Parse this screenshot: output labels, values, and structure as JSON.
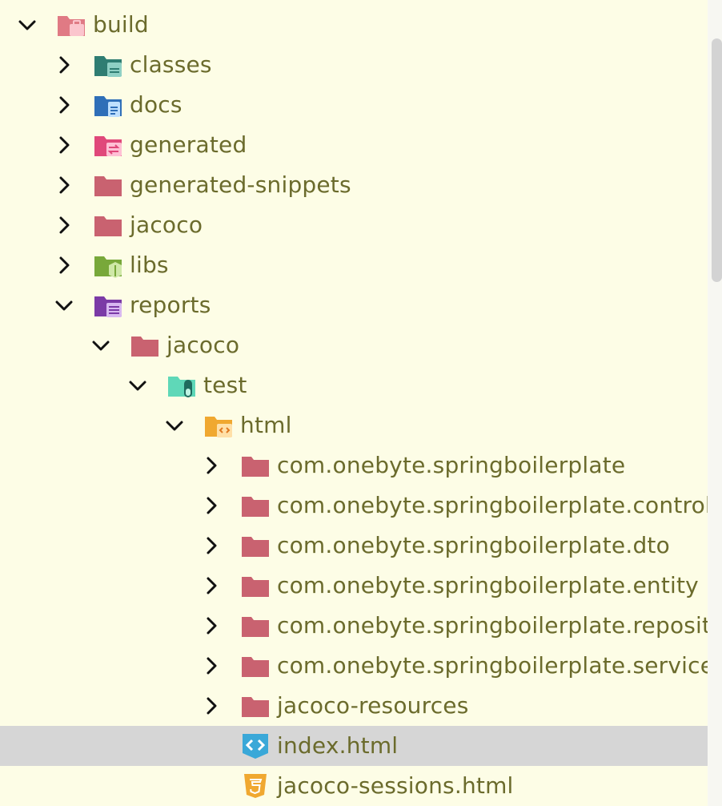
{
  "tree": {
    "items": [
      {
        "label": "build",
        "depth": 0,
        "expanded": true,
        "icon": "folder-build-icon",
        "color": "#e07a84"
      },
      {
        "label": "classes",
        "depth": 1,
        "expanded": false,
        "icon": "folder-classes-icon",
        "color": "#2f7d72"
      },
      {
        "label": "docs",
        "depth": 1,
        "expanded": false,
        "icon": "folder-docs-icon",
        "color": "#2f6fb8"
      },
      {
        "label": "generated",
        "depth": 1,
        "expanded": false,
        "icon": "folder-generated-icon",
        "color": "#e0487a"
      },
      {
        "label": "generated-snippets",
        "depth": 1,
        "expanded": false,
        "icon": "folder-icon",
        "color": "#c96270"
      },
      {
        "label": "jacoco",
        "depth": 1,
        "expanded": false,
        "icon": "folder-icon",
        "color": "#c96270"
      },
      {
        "label": "libs",
        "depth": 1,
        "expanded": false,
        "icon": "folder-libs-icon",
        "color": "#78a83a"
      },
      {
        "label": "reports",
        "depth": 1,
        "expanded": true,
        "icon": "folder-reports-icon",
        "color": "#7b3aa6"
      },
      {
        "label": "jacoco",
        "depth": 2,
        "expanded": true,
        "icon": "folder-icon",
        "color": "#c96270"
      },
      {
        "label": "test",
        "depth": 3,
        "expanded": true,
        "icon": "folder-test-icon",
        "color": "#5fd8b8"
      },
      {
        "label": "html",
        "depth": 4,
        "expanded": true,
        "icon": "folder-html-icon",
        "color": "#f0a830"
      },
      {
        "label": "com.onebyte.springboilerplate",
        "depth": 5,
        "expanded": false,
        "icon": "folder-icon",
        "color": "#c96270"
      },
      {
        "label": "com.onebyte.springboilerplate.controller",
        "depth": 5,
        "expanded": false,
        "icon": "folder-icon",
        "color": "#c96270"
      },
      {
        "label": "com.onebyte.springboilerplate.dto",
        "depth": 5,
        "expanded": false,
        "icon": "folder-icon",
        "color": "#c96270"
      },
      {
        "label": "com.onebyte.springboilerplate.entity",
        "depth": 5,
        "expanded": false,
        "icon": "folder-icon",
        "color": "#c96270"
      },
      {
        "label": "com.onebyte.springboilerplate.repository",
        "depth": 5,
        "expanded": false,
        "icon": "folder-icon",
        "color": "#c96270"
      },
      {
        "label": "com.onebyte.springboilerplate.service",
        "depth": 5,
        "expanded": false,
        "icon": "folder-icon",
        "color": "#c96270"
      },
      {
        "label": "jacoco-resources",
        "depth": 5,
        "expanded": false,
        "icon": "folder-icon",
        "color": "#c96270"
      },
      {
        "label": "index.html",
        "depth": 5,
        "file": true,
        "selected": true,
        "icon": "html-code-file-icon",
        "color": "#3aa8d8"
      },
      {
        "label": "jacoco-sessions.html",
        "depth": 5,
        "file": true,
        "icon": "html5-file-icon",
        "color": "#f0a830"
      }
    ]
  }
}
